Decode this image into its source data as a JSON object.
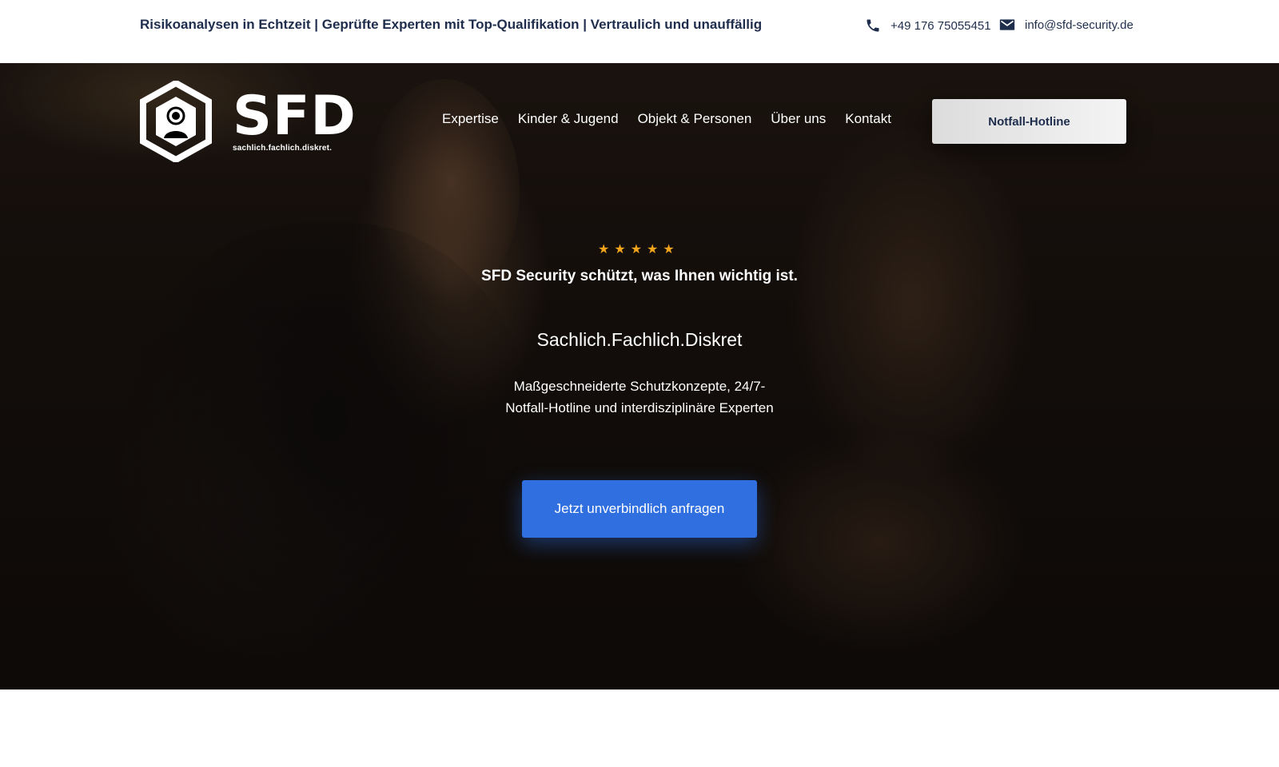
{
  "topbar": {
    "tagline": "Risikoanalysen in Echtzeit | Geprüfte Experten mit Top-Qualifikation | Vertraulich und unauffällig",
    "phone": "+49 176 75055451",
    "email": "info@sfd-security.de",
    "phone_icon": "phone-icon",
    "email_icon": "mail-icon"
  },
  "header": {
    "logo_word": "SFD",
    "logo_slogan": "sachlich.fachlich.diskret.",
    "nav": [
      {
        "label": "Expertise"
      },
      {
        "label": "Kinder & Jugend"
      },
      {
        "label": "Objekt & Personen"
      },
      {
        "label": "Über uns"
      },
      {
        "label": "Kontakt"
      }
    ],
    "hotline_label": "Notfall-Hotline"
  },
  "hero": {
    "rating": 5,
    "star_glyph": "★",
    "subtitle": "SFD Security schützt, was Ihnen wichtig ist.",
    "title": "Sachlich.Fachlich.Diskret",
    "description": "Maßgeschneiderte Schutzkonzepte, 24/7-Notfall-Hotline und interdisziplinäre Experten",
    "cta_label": "Jetzt unverbindlich anfragen"
  },
  "colors": {
    "accent": "#2f6fe0",
    "star": "#f2a51c",
    "navy": "#1f2d4d"
  }
}
